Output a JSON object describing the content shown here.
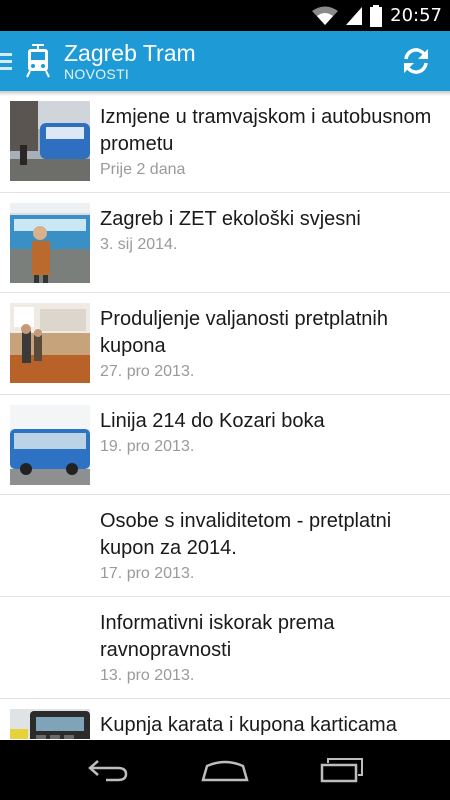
{
  "status_bar": {
    "time": "20:57",
    "icons": [
      "wifi-icon",
      "signal-icon",
      "battery-icon"
    ]
  },
  "action_bar": {
    "title": "Zagreb Tram",
    "subtitle": "NOVOSTI",
    "icons": [
      "drawer-icon",
      "tram-icon",
      "refresh-icon"
    ],
    "color": "#1e9bd7"
  },
  "news": [
    {
      "title": "Izmjene u tramvajskom i autobusnom prometu",
      "date": "Prije 2 dana",
      "thumbnail": "tram-photo"
    },
    {
      "title": "Zagreb i ZET ekološki svjesni",
      "date": "3. sij 2014.",
      "thumbnail": "bus-station-photo"
    },
    {
      "title": "Produljenje valjanosti pretplatnih kupona",
      "date": "27. pro 2013.",
      "thumbnail": "ticket-office-photo"
    },
    {
      "title": "Linija 214 do Kozari boka",
      "date": "19. pro 2013.",
      "thumbnail": "bus-photo"
    },
    {
      "title": "Osobe s invaliditetom - pretplatni kupon za 2014.",
      "date": "17. pro 2013.",
      "thumbnail": ""
    },
    {
      "title": "Informativni iskorak prema ravnopravnosti",
      "date": "13. pro 2013.",
      "thumbnail": ""
    },
    {
      "title": "Kupnja karata i kupona karticama",
      "date": "",
      "thumbnail": "card-terminal-photo"
    }
  ],
  "nav_bar": {
    "icons": [
      "back-icon",
      "home-icon",
      "recent-apps-icon"
    ]
  }
}
